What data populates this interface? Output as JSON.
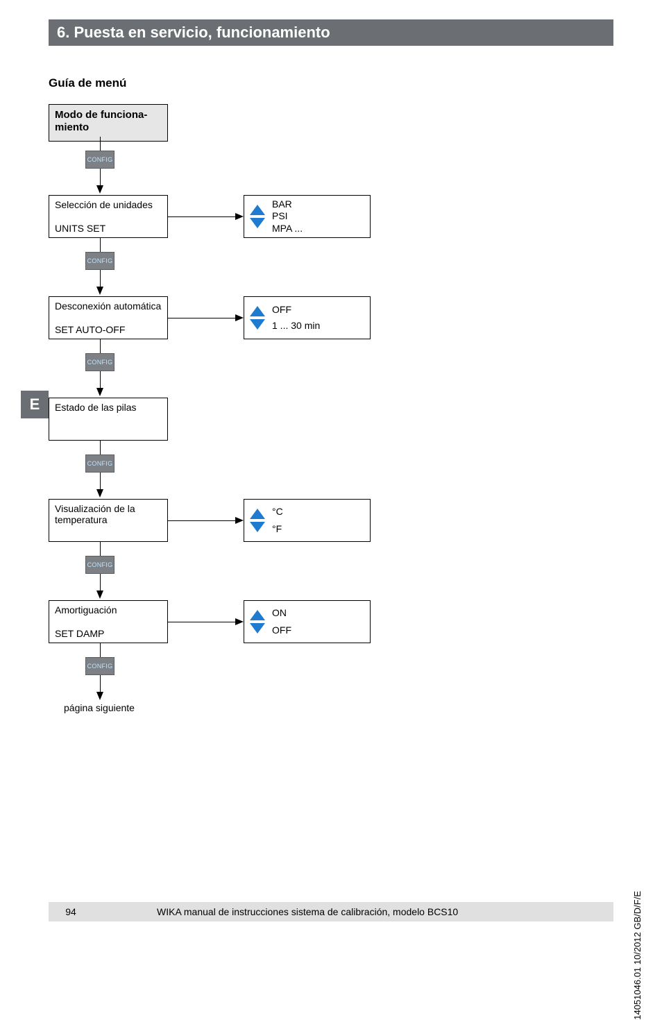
{
  "header": "6. Puesta en servicio, funcionamiento",
  "side_tab": "E",
  "subtitle": "Guía de menú",
  "start_box": "Modo de funciona-\nmiento",
  "config_label": "CONFIG",
  "menu": {
    "units": {
      "title": "Selección de unidades",
      "code": "UNITS SET",
      "options": [
        "BAR",
        "PSI",
        "MPA ..."
      ]
    },
    "autooff": {
      "title": "Desconexión automática",
      "code": "SET AUTO-OFF",
      "options": [
        "OFF",
        "1 ... 30 min"
      ]
    },
    "battery": {
      "title": "Estado de las pilas",
      "code": ""
    },
    "temp": {
      "title": "Visualización de la temperatura",
      "code": "",
      "options": [
        "°C",
        "°F"
      ]
    },
    "damp": {
      "title": "Amortiguación",
      "code": "SET DAMP",
      "options": [
        "ON",
        "OFF"
      ]
    }
  },
  "next_page": "página siguiente",
  "footer": {
    "page": "94",
    "text": "WIKA manual de instrucciones sistema de calibración, modelo BCS10"
  },
  "side_note": "14051046.01 10/2012 GB/D/F/E"
}
